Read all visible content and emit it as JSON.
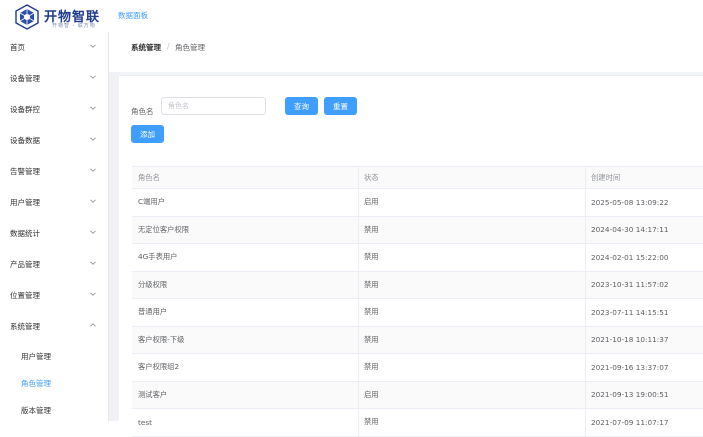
{
  "header": {
    "logo_title": "开物智联",
    "logo_sub": "开物智 · 联万物",
    "tab": "数据面板"
  },
  "sidebar": {
    "items": [
      {
        "label": "首页",
        "expanded": false
      },
      {
        "label": "设备管理",
        "expanded": false
      },
      {
        "label": "设备群控",
        "expanded": false
      },
      {
        "label": "设备数据",
        "expanded": false
      },
      {
        "label": "告警管理",
        "expanded": false
      },
      {
        "label": "用户管理",
        "expanded": false
      },
      {
        "label": "数据统计",
        "expanded": false
      },
      {
        "label": "产品管理",
        "expanded": false
      },
      {
        "label": "位置管理",
        "expanded": false
      },
      {
        "label": "系统管理",
        "expanded": true
      }
    ],
    "sub_items": [
      {
        "label": "用户管理",
        "active": false
      },
      {
        "label": "角色管理",
        "active": true
      },
      {
        "label": "版本管理",
        "active": false
      }
    ]
  },
  "breadcrumb": {
    "parent": "系统管理",
    "separator": "/",
    "current": "角色管理"
  },
  "search": {
    "label": "角色名",
    "value": "",
    "placeholder": "角色名",
    "query_label": "查询",
    "reset_label": "重置",
    "add_label": "添加"
  },
  "table": {
    "headers": [
      "角色名",
      "状态",
      "创建时间"
    ],
    "rows": [
      {
        "name": "C端用户",
        "status": "启用",
        "created": "2025-05-08 13:09:22"
      },
      {
        "name": "无定位客户权限",
        "status": "禁用",
        "created": "2024-04-30 14:17:11"
      },
      {
        "name": "4G手表用户",
        "status": "禁用",
        "created": "2024-02-01 15:22:00"
      },
      {
        "name": "分级权限",
        "status": "禁用",
        "created": "2023-10-31 11:57:02"
      },
      {
        "name": "普通用户",
        "status": "禁用",
        "created": "2023-07-11 14:15:51"
      },
      {
        "name": "客户权限-下级",
        "status": "禁用",
        "created": "2021-10-18 10:11:37"
      },
      {
        "name": "客户权限组2",
        "status": "禁用",
        "created": "2021-09-16 13:37:07"
      },
      {
        "name": "测试客户",
        "status": "启用",
        "created": "2021-09-13 19:00:51"
      },
      {
        "name": "test",
        "status": "禁用",
        "created": "2021-07-09 11:07:17"
      }
    ]
  },
  "colors": {
    "primary": "#409eff",
    "sidebar_bg": "#ffffff",
    "main_bg": "#f0f2f5",
    "logo": "#1f3b8c"
  }
}
